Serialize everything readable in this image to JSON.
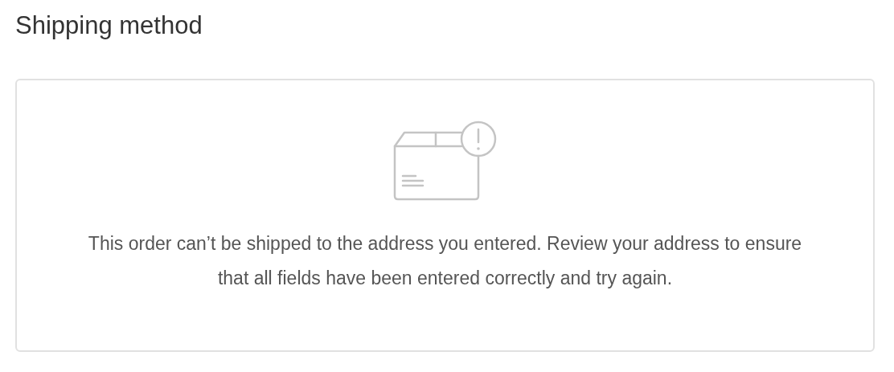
{
  "heading": "Shipping method",
  "notice": {
    "message": "This order can’t be shipped to the address you entered. Review your address to ensure that all fields have been entered correctly and try again."
  }
}
